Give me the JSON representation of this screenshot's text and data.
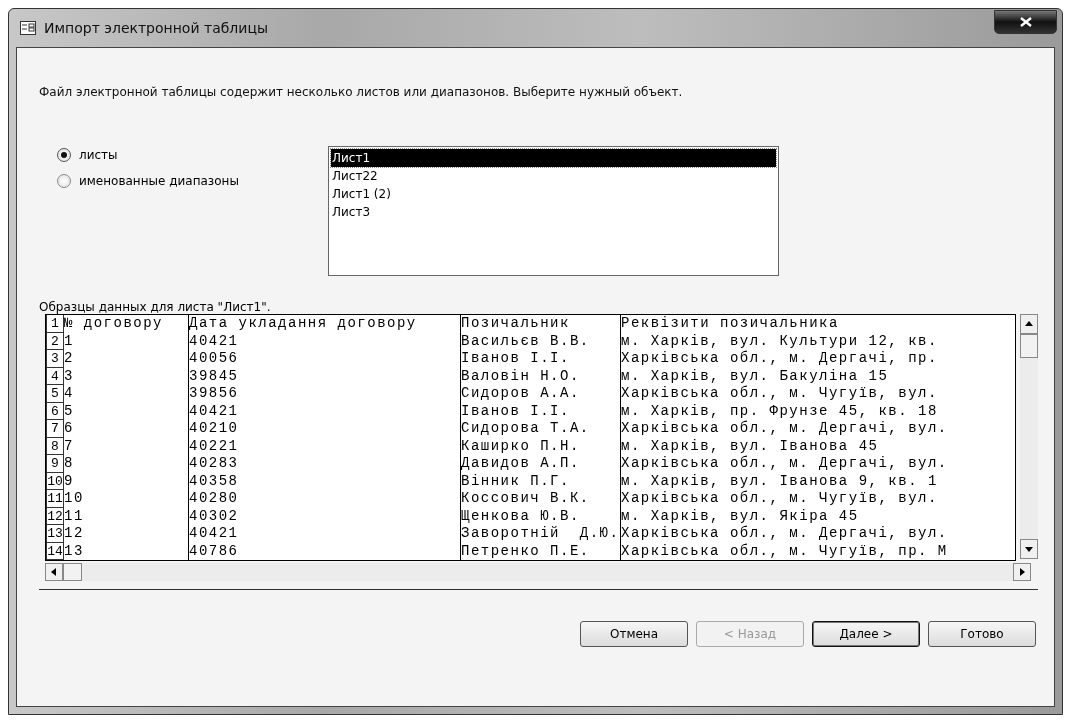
{
  "window": {
    "title": "Импорт электронной таблицы"
  },
  "instruction": "Файл электронной таблицы содержит несколько листов или диапазонов.  Выберите нужный объект.",
  "options": [
    {
      "label": "листы",
      "selected": true
    },
    {
      "label": "именованные диапазоны",
      "selected": false
    }
  ],
  "sheets": [
    {
      "label": "Лист1",
      "selected": true
    },
    {
      "label": "Лист22",
      "selected": false
    },
    {
      "label": "Лист1 (2)",
      "selected": false
    },
    {
      "label": "Лист3",
      "selected": false
    }
  ],
  "preview_label": "Образцы данных для листа \"Лист1\".",
  "table": {
    "rows": [
      {
        "number": "1",
        "cells": [
          "№ договору",
          "Дата укладання договору",
          "Позичальник",
          "Реквізити позичальника"
        ]
      },
      {
        "number": "2",
        "cells": [
          "1",
          "40421",
          "Васильєв В.В.",
          "м. Харків, вул. Культури 12, кв."
        ]
      },
      {
        "number": "3",
        "cells": [
          "2",
          "40056",
          "Іванов І.І.",
          "Харківська обл., м. Дергачі, пр."
        ]
      },
      {
        "number": "4",
        "cells": [
          "3",
          "39845",
          "Валовін Н.О.",
          "м. Харків, вул. Бакуліна 15"
        ]
      },
      {
        "number": "5",
        "cells": [
          "4",
          "39856",
          "Сидоров А.А.",
          "Харківська обл., м. Чугуїв, вул."
        ]
      },
      {
        "number": "6",
        "cells": [
          "5",
          "40421",
          "Іванов І.І.",
          "м. Харків, пр. Фрунзе 45, кв. 18"
        ]
      },
      {
        "number": "7",
        "cells": [
          "6",
          "40210",
          "Сидорова Т.А.",
          "Харківська обл., м. Дергачі, вул."
        ]
      },
      {
        "number": "8",
        "cells": [
          "7",
          "40221",
          "Каширко П.Н.",
          "м. Харків, вул. Іванова 45"
        ]
      },
      {
        "number": "9",
        "cells": [
          "8",
          "40283",
          "Давидов А.П.",
          "Харківська обл., м. Дергачі, вул."
        ]
      },
      {
        "number": "10",
        "cells": [
          "9",
          "40358",
          "Вінник П.Г.",
          "м. Харків, вул. Іванова 9, кв. 1"
        ]
      },
      {
        "number": "11",
        "cells": [
          "10",
          "40280",
          "Коссович В.К.",
          "Харківська обл., м. Чугуїв, вул."
        ]
      },
      {
        "number": "12",
        "cells": [
          "11",
          "40302",
          "Щенкова Ю.В.",
          "м. Харків, вул. Якіра 45"
        ]
      },
      {
        "number": "13",
        "cells": [
          "12",
          "40421",
          "Заворотній  Д.Ю.",
          "Харківська обл., м. Дергачі, вул."
        ]
      },
      {
        "number": "14",
        "cells": [
          "13",
          "40786",
          "Петренко П.Е.",
          "Харківська обл., м. Чугуїв, пр. М"
        ]
      }
    ]
  },
  "buttons": [
    {
      "label": "Отмена",
      "disabled": false,
      "default": false
    },
    {
      "label": "< Назад",
      "disabled": true,
      "default": false
    },
    {
      "label": "Далее >",
      "disabled": false,
      "default": true
    },
    {
      "label": "Готово",
      "disabled": false,
      "default": false
    }
  ]
}
